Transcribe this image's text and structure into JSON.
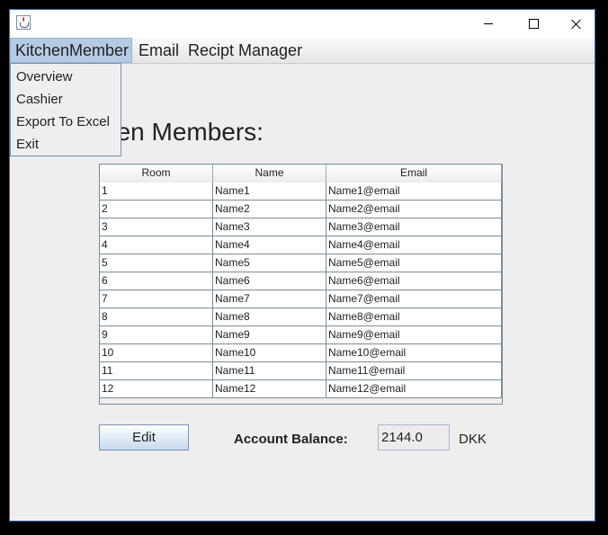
{
  "menubar": {
    "items": [
      "KitchenMember",
      "Email",
      "Recipt Manager"
    ]
  },
  "dropdown": {
    "items": [
      "Overview",
      "Cashier",
      "Export To Excel",
      "Exit"
    ]
  },
  "heading": "itchen Members:",
  "table": {
    "columns": [
      "Room",
      "Name",
      "Email"
    ],
    "rows": [
      [
        "1",
        "Name1",
        "Name1@email"
      ],
      [
        "2",
        "Name2",
        "Name2@email"
      ],
      [
        "3",
        "Name3",
        "Name3@email"
      ],
      [
        "4",
        "Name4",
        "Name4@email"
      ],
      [
        "5",
        "Name5",
        "Name5@email"
      ],
      [
        "6",
        "Name6",
        "Name6@email"
      ],
      [
        "7",
        "Name7",
        "Name7@email"
      ],
      [
        "8",
        "Name8",
        "Name8@email"
      ],
      [
        "9",
        "Name9",
        "Name9@email"
      ],
      [
        "10",
        "Name10",
        "Name10@email"
      ],
      [
        "11",
        "Name11",
        "Name11@email"
      ],
      [
        "12",
        "Name12",
        "Name12@email"
      ]
    ]
  },
  "footer": {
    "edit_label": "Edit",
    "balance_label": "Account Balance:",
    "balance_value": "2144.0",
    "currency": "DKK"
  },
  "icons": {
    "app": "java-cup-icon",
    "minimize": "minimize-icon",
    "maximize": "maximize-icon",
    "close": "close-icon"
  },
  "colors": {
    "menu_active": "#b6cbe3",
    "window_border": "#3a6fb0",
    "button_gradient_bottom": "#c7d9ee"
  }
}
